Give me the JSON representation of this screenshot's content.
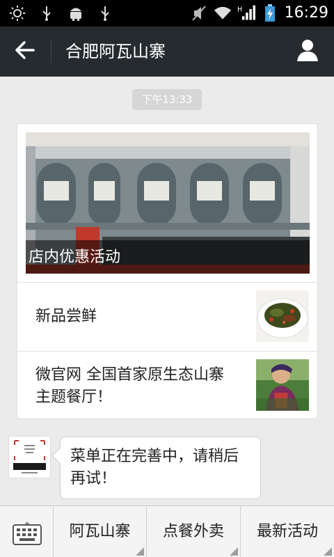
{
  "status_bar": {
    "icons": [
      "brightness-icon",
      "usb-icon",
      "android-icon",
      "usb-icon",
      "mute-icon",
      "wifi-icon",
      "signal-icon",
      "battery-icon"
    ],
    "time": "16:29"
  },
  "header": {
    "title": "合肥阿瓦山寨",
    "back_icon": "back-arrow-icon",
    "profile_icon": "person-icon"
  },
  "timestamp": "下午13:33",
  "news_card": {
    "hero_title": "店内优惠活动",
    "items": [
      {
        "title": "新品尝鲜"
      },
      {
        "title": "微官网 全国首家原生态山寨主题餐厅！"
      }
    ]
  },
  "message": {
    "text": "菜单正在完善中，请稍后再试！"
  },
  "bottom_menu": {
    "keyboard_icon": "keyboard-icon",
    "items": [
      "阿瓦山寨",
      "点餐外卖",
      "最新活动"
    ]
  }
}
